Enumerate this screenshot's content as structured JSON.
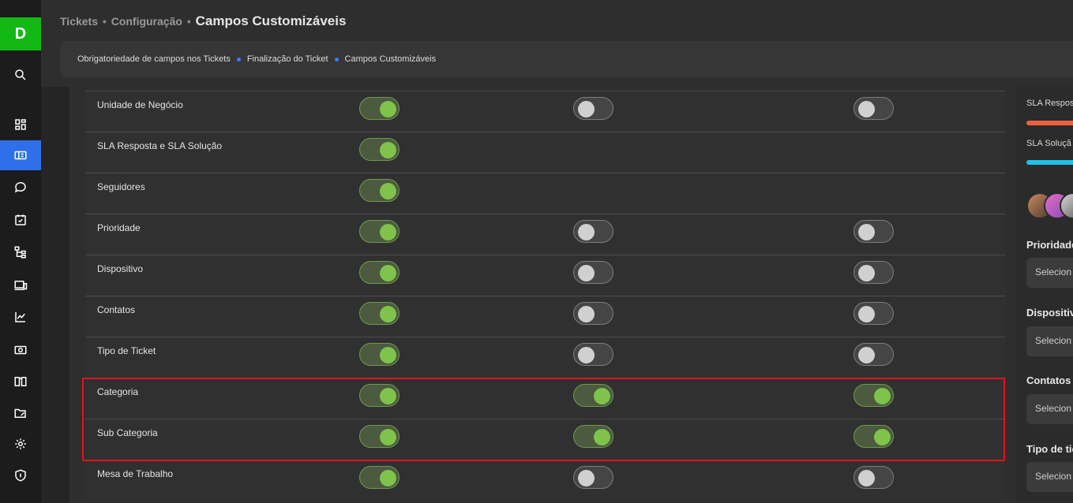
{
  "sidebar": {
    "logo": "D",
    "icons": [
      "search-icon",
      "dashboard-icon",
      "ticket-icon",
      "chat-icon",
      "calendar-check-icon",
      "tree-icon",
      "devices-icon",
      "chart-icon",
      "money-icon",
      "book-icon",
      "folder-edit-icon",
      "gear-icon",
      "shield-icon"
    ]
  },
  "breadcrumb": {
    "item1": "Tickets",
    "sep": "•",
    "item2": "Configuração",
    "current": "Campos Customizáveis"
  },
  "subnav": {
    "tab1": "Obrigatoriedade de campos nos Tickets",
    "tab2": "Finalização do Ticket",
    "tab3": "Campos Customizáveis"
  },
  "rows": [
    {
      "label": "Unidade de Negócio",
      "toggles": [
        true,
        false,
        false
      ]
    },
    {
      "label": "SLA Resposta e SLA Solução",
      "toggles": [
        true
      ]
    },
    {
      "label": "Seguidores",
      "toggles": [
        true
      ]
    },
    {
      "label": "Prioridade",
      "toggles": [
        true,
        false,
        false
      ]
    },
    {
      "label": "Dispositivo",
      "toggles": [
        true,
        false,
        false
      ]
    },
    {
      "label": "Contatos",
      "toggles": [
        true,
        false,
        false
      ]
    },
    {
      "label": "Tipo de Ticket",
      "toggles": [
        true,
        false,
        false
      ]
    },
    {
      "label": "Categoria",
      "toggles": [
        true,
        true,
        true
      ]
    },
    {
      "label": "Sub Categoria",
      "toggles": [
        true,
        true,
        true
      ]
    },
    {
      "label": "Mesa de Trabalho",
      "toggles": [
        true,
        false,
        false
      ]
    }
  ],
  "right_panel": {
    "sla_resposta": "SLA Respost",
    "sla_solucao": "SLA Soluçã",
    "prioridade": "Prioridade",
    "dispositivo": "Dispositivo",
    "contatos": "Contatos",
    "tipo": "Tipo de tic",
    "select_placeholder": "Selecion",
    "colors": {
      "sla_resposta": "#f0603c",
      "sla_solucao": "#1ec2e6"
    }
  },
  "colors": {
    "accent": "#2f6fe8",
    "brand": "#14b814",
    "toggle_on": "#7fc34c",
    "highlight": "#e0151f"
  }
}
